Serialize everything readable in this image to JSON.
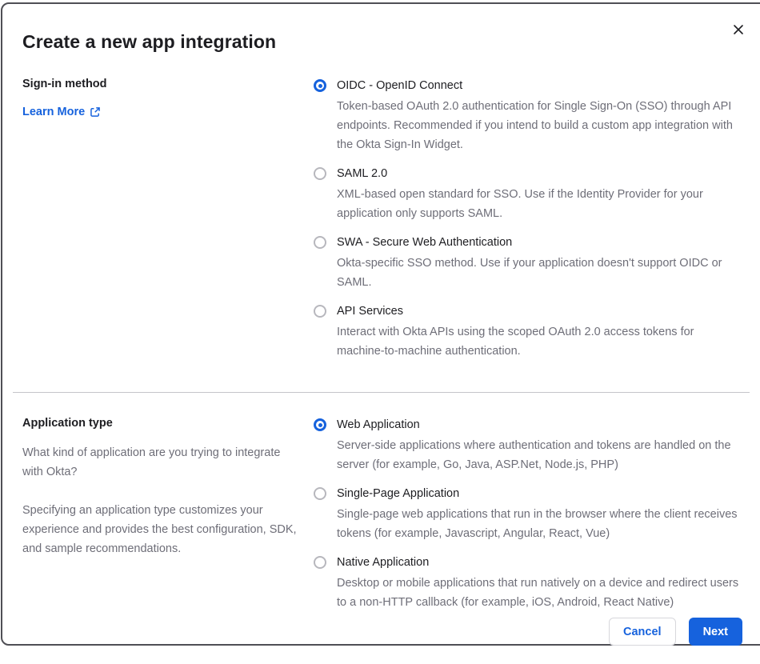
{
  "modal": {
    "title": "Create a new app integration"
  },
  "signin_section": {
    "heading": "Sign-in method",
    "learn_more_label": "Learn More",
    "options": [
      {
        "id": "oidc",
        "label": "OIDC - OpenID Connect",
        "description": "Token-based OAuth 2.0 authentication for Single Sign-On (SSO) through API endpoints. Recommended if you intend to build a custom app integration with the Okta Sign-In Widget.",
        "selected": true
      },
      {
        "id": "saml",
        "label": "SAML 2.0",
        "description": "XML-based open standard for SSO. Use if the Identity Provider for your application only supports SAML.",
        "selected": false
      },
      {
        "id": "swa",
        "label": "SWA - Secure Web Authentication",
        "description": "Okta-specific SSO method. Use if your application doesn't support OIDC or SAML.",
        "selected": false
      },
      {
        "id": "api-services",
        "label": "API Services",
        "description": "Interact with Okta APIs using the scoped OAuth 2.0 access tokens for machine-to-machine authentication.",
        "selected": false
      }
    ]
  },
  "apptype_section": {
    "heading": "Application type",
    "paragraphs": [
      "What kind of application are you trying to integrate with Okta?",
      "Specifying an application type customizes your experience and provides the best configuration, SDK, and sample recommendations."
    ],
    "options": [
      {
        "id": "web-application",
        "label": "Web Application",
        "description": "Server-side applications where authentication and tokens are handled on the server (for example, Go, Java, ASP.Net, Node.js, PHP)",
        "selected": true
      },
      {
        "id": "single-page-application",
        "label": "Single-Page Application",
        "description": "Single-page web applications that run in the browser where the client receives tokens (for example, Javascript, Angular, React, Vue)",
        "selected": false
      },
      {
        "id": "native-application",
        "label": "Native Application",
        "description": "Desktop or mobile applications that run natively on a device and redirect users to a non-HTTP callback (for example, iOS, Android, React Native)",
        "selected": false
      }
    ]
  },
  "footer": {
    "cancel_label": "Cancel",
    "next_label": "Next"
  },
  "colors": {
    "primary_blue": "#1662dd",
    "text_dark": "#1d1d21",
    "text_gray": "#6e6e78",
    "divider": "#c4c4ca",
    "modal_border": "#4f4f55"
  }
}
